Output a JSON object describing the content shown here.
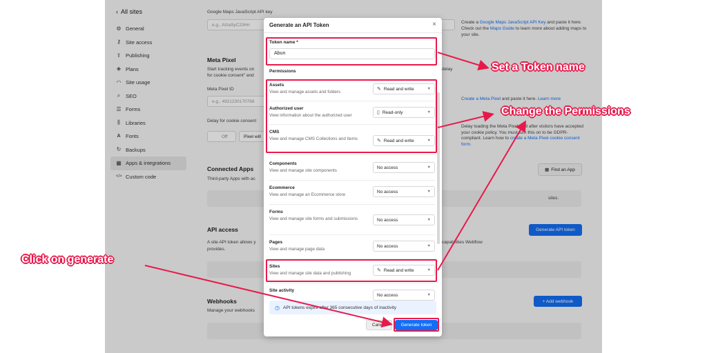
{
  "sidebar": {
    "back_label": "All sites",
    "items": [
      {
        "label": "General",
        "icon": "gear-icon"
      },
      {
        "label": "Site access",
        "icon": "key-icon"
      },
      {
        "label": "Publishing",
        "icon": "upload-icon"
      },
      {
        "label": "Plans",
        "icon": "layers-icon"
      },
      {
        "label": "Site usage",
        "icon": "gauge-icon"
      },
      {
        "label": "SEO",
        "icon": "search-icon"
      },
      {
        "label": "Forms",
        "icon": "form-icon"
      },
      {
        "label": "Libraries",
        "icon": "library-icon"
      },
      {
        "label": "Fonts",
        "icon": "font-icon"
      },
      {
        "label": "Backups",
        "icon": "refresh-icon"
      },
      {
        "label": "Apps & integrations",
        "icon": "grid-icon"
      },
      {
        "label": "Custom code",
        "icon": "code-icon"
      }
    ]
  },
  "background": {
    "maps_label": "Google Maps JavaScript API key",
    "maps_placeholder": "e.g., AIzaSyC23Hn",
    "maps_help_1": "Create a ",
    "maps_help_link": "Google Maps JavaScript API Key",
    "maps_help_2": " and paste it here. Check out the ",
    "maps_help_link2": "Maps Guide",
    "maps_help_3": " to learn more about adding maps to your site.",
    "meta_title": "Meta Pixel",
    "meta_desc": "Start tracking events on",
    "meta_desc2": "for cookie consent\" and",
    "meta_desc_right": "delay",
    "meta_id_label": "Meta Pixel ID",
    "meta_id_placeholder": "e.g., 4921230170768",
    "meta_help_link": "Create a Meta Pixel",
    "meta_help_rest": " and paste it here. ",
    "meta_learn": "Learn more",
    "delay_label": "Delay for cookie consent",
    "toggle_off": "Off",
    "pixel_select": "Pixel will",
    "delay_help": "Delay loading the Meta Pixel until after visitors have accepted your cookie policy. You must turn this on to be GDPR-compliant. Learn how to ",
    "delay_help_link": "create a Meta Pixel cookie consent form.",
    "connected_title": "Connected Apps",
    "connected_desc": "Third-party Apps with ac",
    "find_app": "Find an App",
    "sites_text": "sites.",
    "api_title": "API access",
    "api_desc": "A site API token allows y",
    "api_desc_right": "capabilities Webflow",
    "api_desc2": "provides.",
    "generate_api": "Generate API token",
    "webhooks_title": "Webhooks",
    "webhooks_desc": "Manage your webhooks",
    "add_webhook": "+ Add webhook"
  },
  "modal": {
    "title": "Generate an API Token",
    "token_label": "Token name *",
    "token_value": "Abun",
    "permissions_heading": "Permissions",
    "permissions": [
      {
        "name": "Assets",
        "desc": "View and manage assets and folders",
        "value": "Read and write",
        "icon": "pencil-icon"
      },
      {
        "name": "Authorized user",
        "desc": "View information about the authorized user",
        "value": "Read-only",
        "icon": "book-icon"
      },
      {
        "name": "CMS",
        "desc": "View and manage CMS Collections and Items",
        "value": "Read and write",
        "icon": "pencil-icon"
      },
      {
        "name": "Components",
        "desc": "View and manage site components",
        "value": "No access",
        "icon": ""
      },
      {
        "name": "Ecommerce",
        "desc": "View and manage an Ecommerce store",
        "value": "No access",
        "icon": ""
      },
      {
        "name": "Forms",
        "desc": "View and manage site forms and submissions",
        "value": "No access",
        "icon": ""
      },
      {
        "name": "Pages",
        "desc": "View and manage page data",
        "value": "No access",
        "icon": ""
      },
      {
        "name": "Sites",
        "desc": "View and manage site data and publishing",
        "value": "Read and write",
        "icon": "pencil-icon"
      },
      {
        "name": "Site activity",
        "desc": "",
        "value": "No access",
        "icon": ""
      }
    ],
    "info_text": "API tokens expire after 365 consecutive days of inactivity",
    "cancel_label": "Cancel",
    "generate_label": "Generate token"
  },
  "annotations": {
    "token_name": "Set a Token name",
    "permissions": "Change the Permissions",
    "generate": "Click on generate",
    "color": "#e8194a"
  }
}
